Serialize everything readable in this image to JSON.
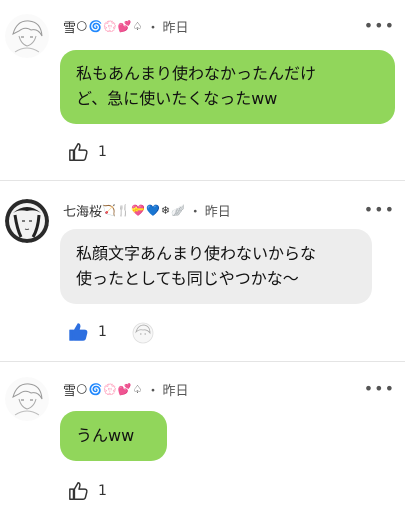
{
  "posts": [
    {
      "username": "雪",
      "emoji": [
        "🌕",
        "🌀",
        "💮",
        "💕",
        "♤"
      ],
      "dot": "・",
      "time": "昨日",
      "more": "•••",
      "lines": [
        "私もあんまり使わなかったんだけ",
        "ど、急に使いたくなったww"
      ],
      "likes": "1",
      "liked": false
    },
    {
      "username": "七海桜",
      "emoji": [
        "🏹",
        "🍴",
        "💝",
        "💙",
        "❄",
        "🪽"
      ],
      "dot": "・",
      "time": "昨日",
      "more": "•••",
      "lines": [
        "私顔文字あんまり使わないからな",
        "使ったとしても同じやつかな〜"
      ],
      "likes": "1",
      "liked": true
    },
    {
      "username": "雪",
      "emoji": [
        "🌕",
        "🌀",
        "💮",
        "💕",
        "♤"
      ],
      "dot": "・",
      "time": "昨日",
      "more": "•••",
      "lines": [
        "うんww"
      ],
      "likes": "1",
      "liked": false
    }
  ],
  "colors": {
    "bubble_green": "#91d65b",
    "bubble_gray": "#ededed",
    "like_active": "#2d6fe0"
  }
}
